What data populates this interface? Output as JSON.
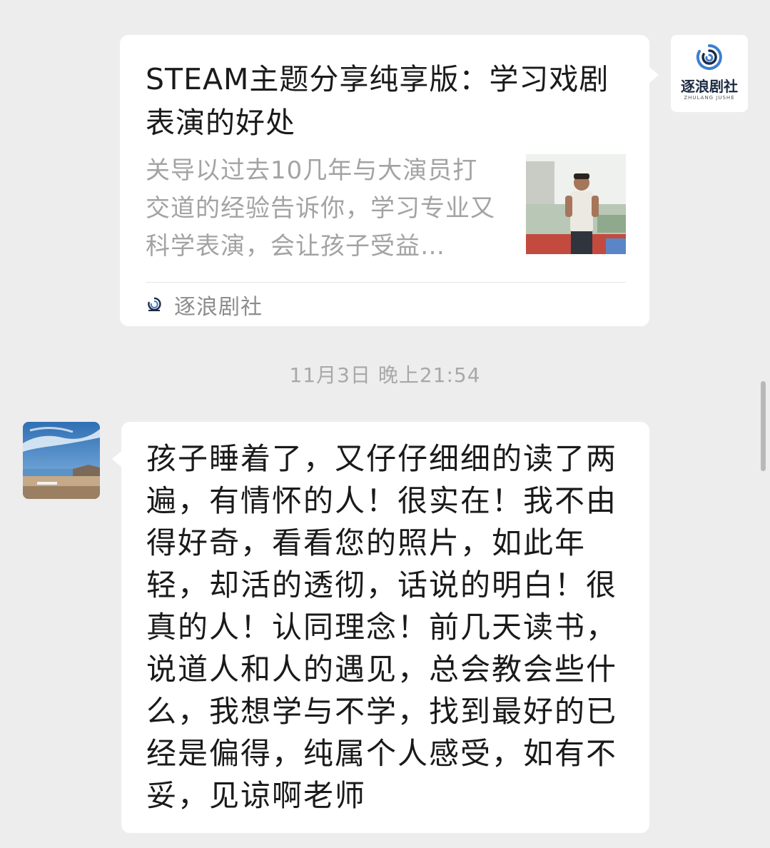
{
  "article": {
    "title": "STEAM主题分享纯享版：学习戏剧表演的好处",
    "description": "关导以过去10几年与大演员打交道的经验告诉你，学习专业又科学表演，会让孩子受益…",
    "source_name": "逐浪剧社"
  },
  "account_avatar": {
    "brand_text": "逐浪剧社",
    "brand_subtext": "ZHULANG JUSHE"
  },
  "timestamp": "11月3日 晚上21:54",
  "message": {
    "text": "孩子睡着了，又仔仔细细的读了两遍，有情怀的人！很实在！我不由得好奇，看看您的照片，如此年轻，却活的透彻，话说的明白！很真的人！认同理念！前几天读书，说道人和人的遇见，总会教会些什么，我想学与不学，找到最好的已经是偏得，纯属个人感受，如有不妥，见谅啊老师"
  },
  "colors": {
    "background": "#ededed",
    "bubble": "#ffffff",
    "brand_navy": "#1c2a44",
    "brand_blue": "#3c7fd0"
  },
  "icons": {
    "brand_logo": "wave-swirl-icon",
    "avatar_left": "beach-sky-photo"
  }
}
